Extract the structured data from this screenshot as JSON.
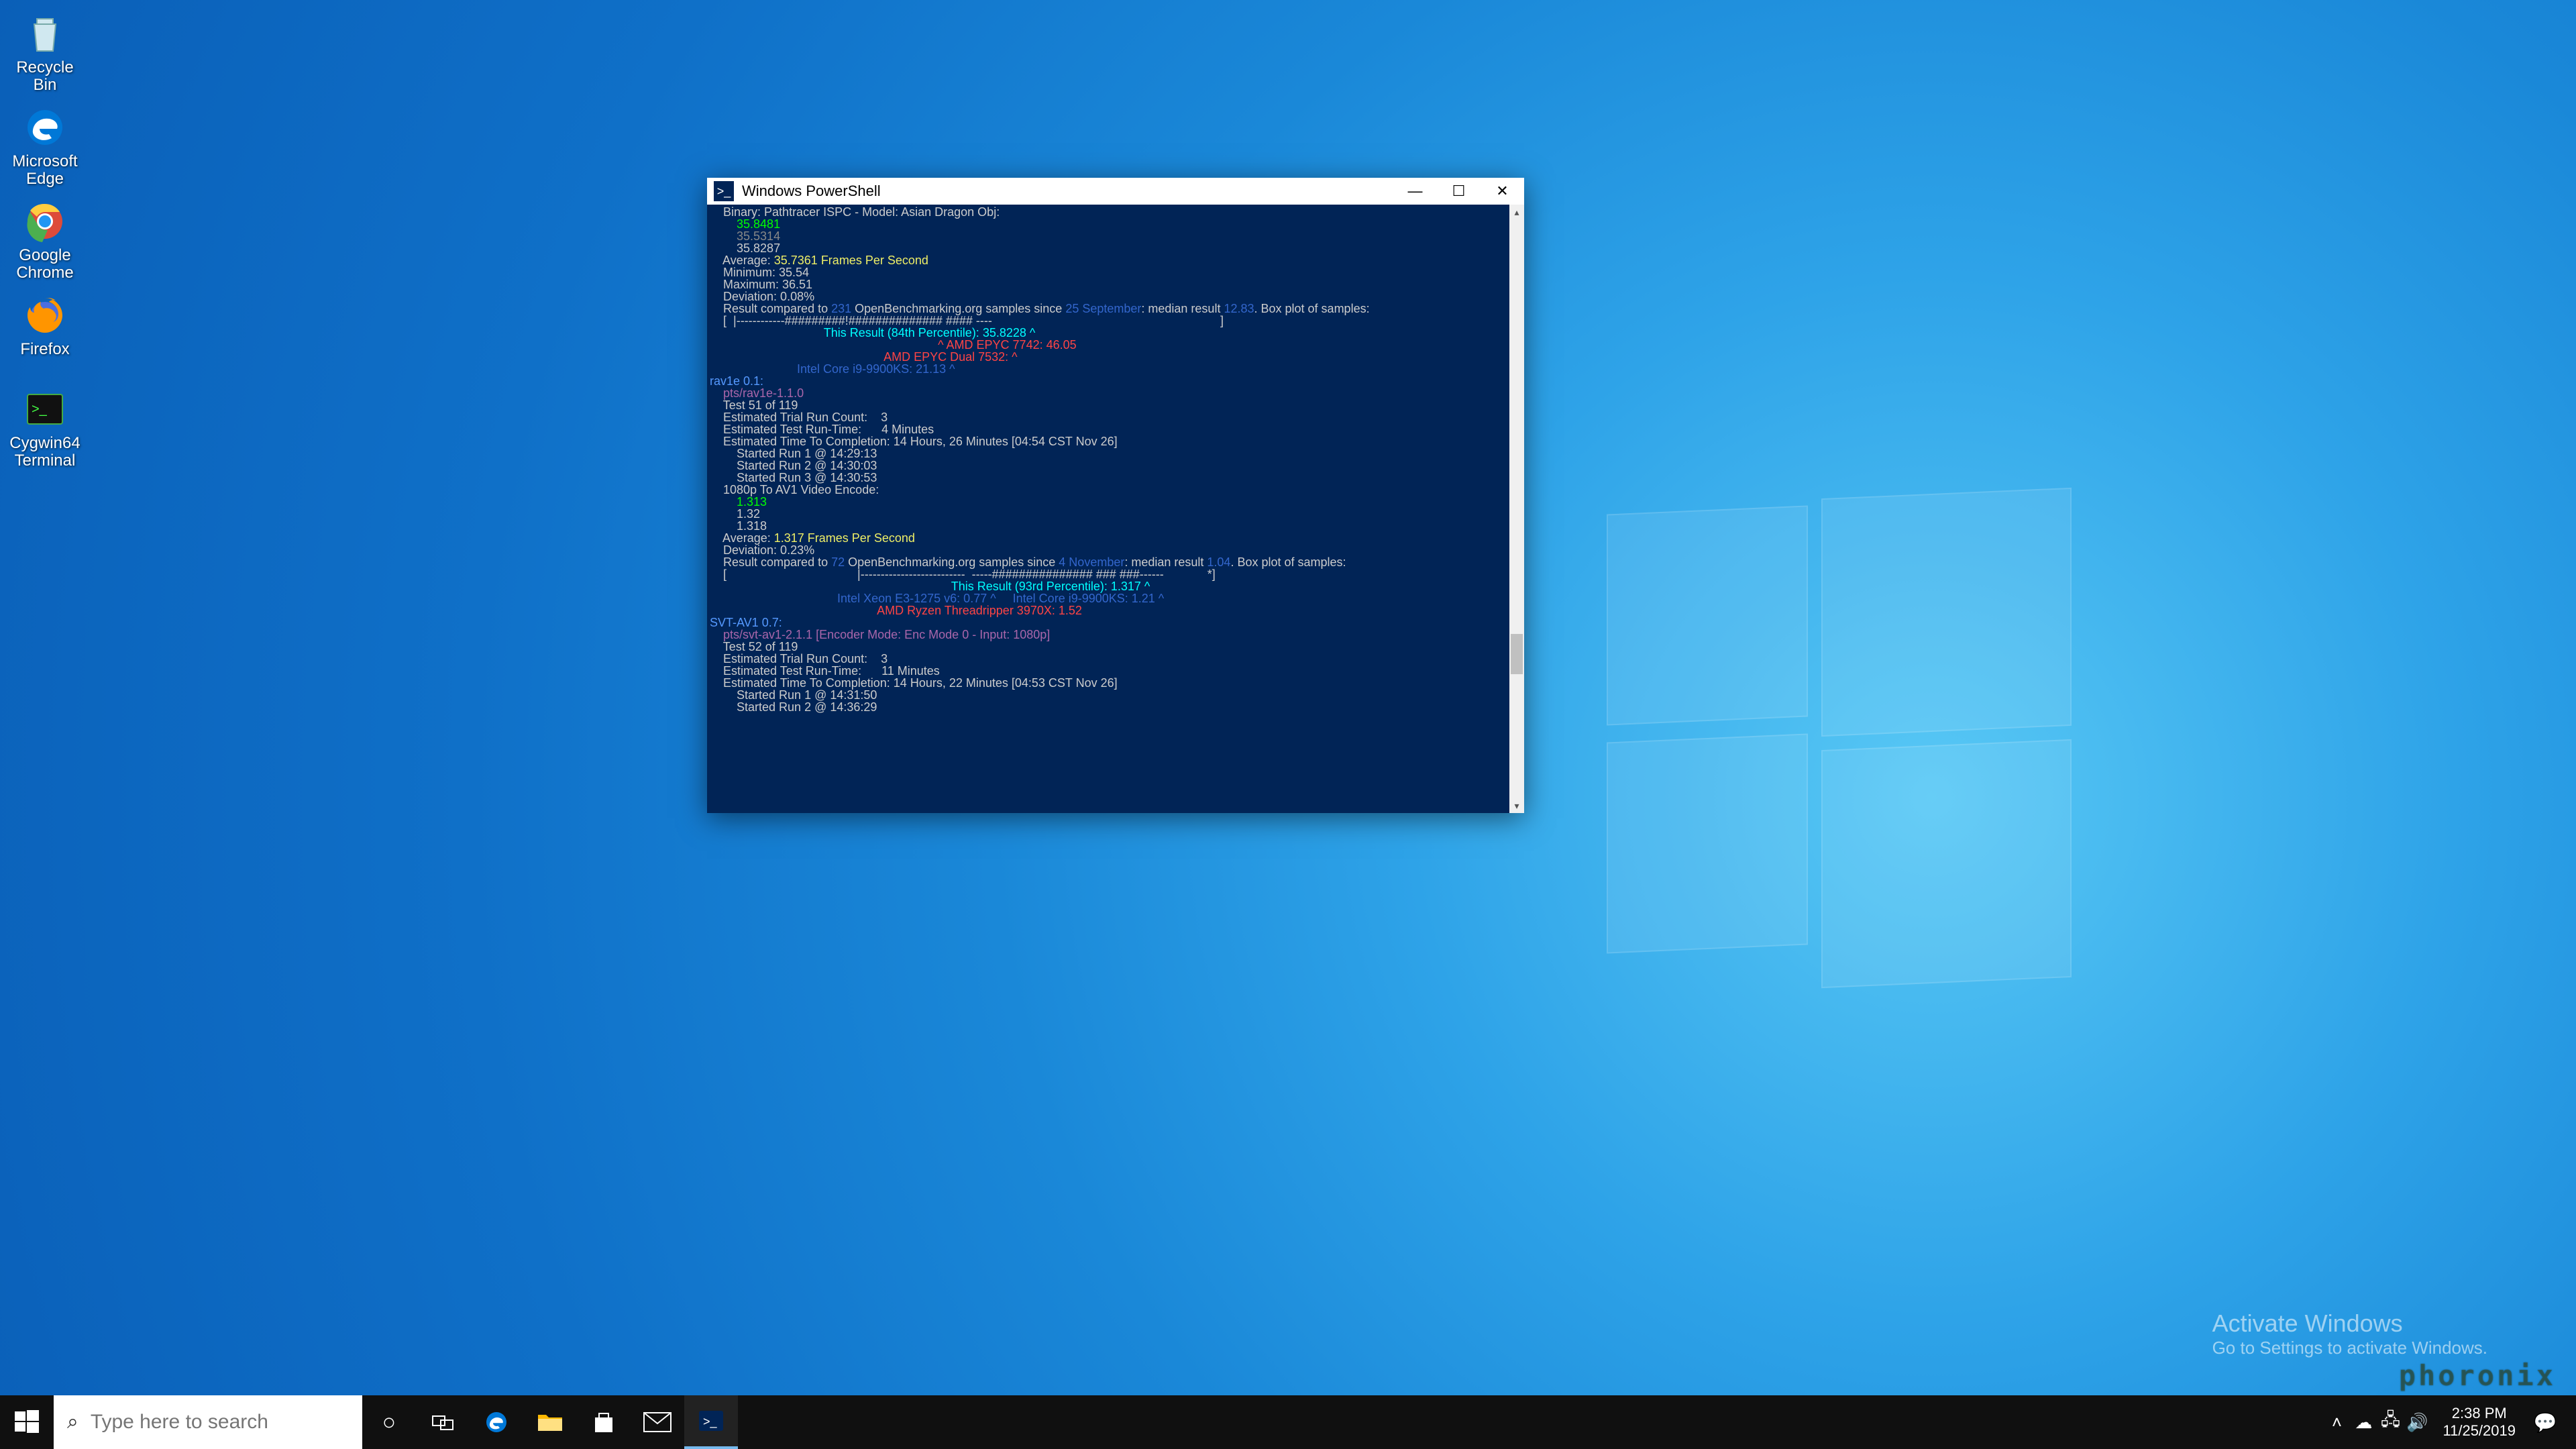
{
  "desktop_icons": [
    {
      "name": "recycle-bin",
      "label": "Recycle Bin"
    },
    {
      "name": "edge",
      "label": "Microsoft Edge"
    },
    {
      "name": "chrome",
      "label": "Google Chrome"
    },
    {
      "name": "firefox",
      "label": "Firefox"
    },
    {
      "name": "cygwin",
      "label": "Cygwin64 Terminal"
    }
  ],
  "window": {
    "title": "Windows PowerShell"
  },
  "terminal": {
    "lines": [
      {
        "indent": 4,
        "spans": [
          {
            "t": "Binary: Pathtracer ISPC - Model: Asian Dragon Obj:"
          }
        ]
      },
      {
        "indent": 8,
        "spans": [
          {
            "t": "35.8481",
            "c": "c-grn"
          }
        ]
      },
      {
        "indent": 8,
        "spans": [
          {
            "t": "35.5314",
            "c": "c-gray"
          }
        ]
      },
      {
        "indent": 8,
        "spans": [
          {
            "t": "35.8287"
          }
        ]
      },
      {
        "indent": 0,
        "spans": [
          {
            "t": ""
          }
        ]
      },
      {
        "indent": 4,
        "spans": [
          {
            "t": "Average: "
          },
          {
            "t": "35.7361 Frames Per Second",
            "c": "c-yel"
          }
        ]
      },
      {
        "indent": 4,
        "spans": [
          {
            "t": "Minimum: 35.54"
          }
        ]
      },
      {
        "indent": 4,
        "spans": [
          {
            "t": "Maximum: 36.51"
          }
        ]
      },
      {
        "indent": 4,
        "spans": [
          {
            "t": "Deviation: 0.08%"
          }
        ]
      },
      {
        "indent": 0,
        "spans": [
          {
            "t": ""
          }
        ]
      },
      {
        "indent": 4,
        "spans": [
          {
            "t": "Result compared to "
          },
          {
            "t": "231",
            "c": "c-dblue"
          },
          {
            "t": " OpenBenchmarking.org samples since "
          },
          {
            "t": "25 September",
            "c": "c-dblue"
          },
          {
            "t": ": median result "
          },
          {
            "t": "12.83",
            "c": "c-dblue"
          },
          {
            "t": ". Box plot of samples:"
          }
        ]
      },
      {
        "indent": 4,
        "spans": [
          {
            "t": "[  |------------#########!############## #### ----                                                                    ]"
          }
        ]
      },
      {
        "indent": 34,
        "spans": [
          {
            "t": "This Result (84th Percentile): 35.8228 ^",
            "c": "c-cyan"
          }
        ]
      },
      {
        "indent": 68,
        "spans": [
          {
            "t": "^ AMD EPYC 7742: 46.05",
            "c": "c-red"
          }
        ]
      },
      {
        "indent": 52,
        "spans": [
          {
            "t": "AMD EPYC Dual 7532: ^",
            "c": "c-red"
          }
        ]
      },
      {
        "indent": 26,
        "spans": [
          {
            "t": "Intel Core i9-9900KS: 21.13 ^",
            "c": "c-dblue"
          }
        ]
      },
      {
        "indent": 0,
        "spans": [
          {
            "t": ""
          }
        ]
      },
      {
        "indent": 0,
        "spans": [
          {
            "t": "rav1e 0.1:",
            "c": "c-blue"
          }
        ]
      },
      {
        "indent": 4,
        "spans": [
          {
            "t": "pts/rav1e-1.1.0",
            "c": "c-mag"
          }
        ]
      },
      {
        "indent": 4,
        "spans": [
          {
            "t": "Test 51 of 119"
          }
        ]
      },
      {
        "indent": 4,
        "spans": [
          {
            "t": "Estimated Trial Run Count:    3"
          }
        ]
      },
      {
        "indent": 4,
        "spans": [
          {
            "t": "Estimated Test Run-Time:      4 Minutes"
          }
        ]
      },
      {
        "indent": 4,
        "spans": [
          {
            "t": "Estimated Time To Completion: 14 Hours, 26 Minutes [04:54 CST Nov 26]"
          }
        ]
      },
      {
        "indent": 8,
        "spans": [
          {
            "t": "Started Run 1 @ 14:29:13"
          }
        ]
      },
      {
        "indent": 8,
        "spans": [
          {
            "t": "Started Run 2 @ 14:30:03"
          }
        ]
      },
      {
        "indent": 8,
        "spans": [
          {
            "t": "Started Run 3 @ 14:30:53"
          }
        ]
      },
      {
        "indent": 0,
        "spans": [
          {
            "t": ""
          }
        ]
      },
      {
        "indent": 4,
        "spans": [
          {
            "t": "1080p To AV1 Video Encode:"
          }
        ]
      },
      {
        "indent": 8,
        "spans": [
          {
            "t": "1.313",
            "c": "c-grn"
          }
        ]
      },
      {
        "indent": 8,
        "spans": [
          {
            "t": "1.32"
          }
        ]
      },
      {
        "indent": 8,
        "spans": [
          {
            "t": "1.318"
          }
        ]
      },
      {
        "indent": 0,
        "spans": [
          {
            "t": ""
          }
        ]
      },
      {
        "indent": 4,
        "spans": [
          {
            "t": "Average: "
          },
          {
            "t": "1.317 Frames Per Second",
            "c": "c-yel"
          }
        ]
      },
      {
        "indent": 4,
        "spans": [
          {
            "t": "Deviation: 0.23%"
          }
        ]
      },
      {
        "indent": 0,
        "spans": [
          {
            "t": ""
          }
        ]
      },
      {
        "indent": 4,
        "spans": [
          {
            "t": "Result compared to "
          },
          {
            "t": "72",
            "c": "c-dblue"
          },
          {
            "t": " OpenBenchmarking.org samples since "
          },
          {
            "t": "4 November",
            "c": "c-dblue"
          },
          {
            "t": ": median result "
          },
          {
            "t": "1.04",
            "c": "c-dblue"
          },
          {
            "t": ". Box plot of samples:"
          }
        ]
      },
      {
        "indent": 4,
        "spans": [
          {
            "t": "[                                       |--------------------------  -----############### ### ###------             *]"
          }
        ]
      },
      {
        "indent": 72,
        "spans": [
          {
            "t": "This Result (93rd Percentile): 1.317 ^",
            "c": "c-cyan"
          }
        ]
      },
      {
        "indent": 38,
        "spans": [
          {
            "t": "Intel Xeon E3-1275 v6: 0.77 ^     Intel Core i9-9900KS: 1.21 ^",
            "c": "c-dblue"
          }
        ]
      },
      {
        "indent": 50,
        "spans": [
          {
            "t": "AMD Ryzen Threadripper 3970X: 1.52",
            "c": "c-red"
          }
        ]
      },
      {
        "indent": 0,
        "spans": [
          {
            "t": ""
          }
        ]
      },
      {
        "indent": 0,
        "spans": [
          {
            "t": "SVT-AV1 0.7:",
            "c": "c-blue"
          }
        ]
      },
      {
        "indent": 4,
        "spans": [
          {
            "t": "pts/svt-av1-2.1.1 [Encoder Mode: Enc Mode 0 - Input: 1080p]",
            "c": "c-mag"
          }
        ]
      },
      {
        "indent": 4,
        "spans": [
          {
            "t": "Test 52 of 119"
          }
        ]
      },
      {
        "indent": 4,
        "spans": [
          {
            "t": "Estimated Trial Run Count:    3"
          }
        ]
      },
      {
        "indent": 4,
        "spans": [
          {
            "t": "Estimated Test Run-Time:      11 Minutes"
          }
        ]
      },
      {
        "indent": 4,
        "spans": [
          {
            "t": "Estimated Time To Completion: 14 Hours, 22 Minutes [04:53 CST Nov 26]"
          }
        ]
      },
      {
        "indent": 8,
        "spans": [
          {
            "t": "Started Run 1 @ 14:31:50"
          }
        ]
      },
      {
        "indent": 8,
        "spans": [
          {
            "t": "Started Run 2 @ 14:36:29"
          }
        ]
      }
    ]
  },
  "activate": {
    "heading": "Activate Windows",
    "sub": "Go to Settings to activate Windows."
  },
  "watermark": "phoronix",
  "taskbar": {
    "search_placeholder": "Type here to search",
    "clock_time": "2:38 PM",
    "clock_date": "11/25/2019"
  }
}
